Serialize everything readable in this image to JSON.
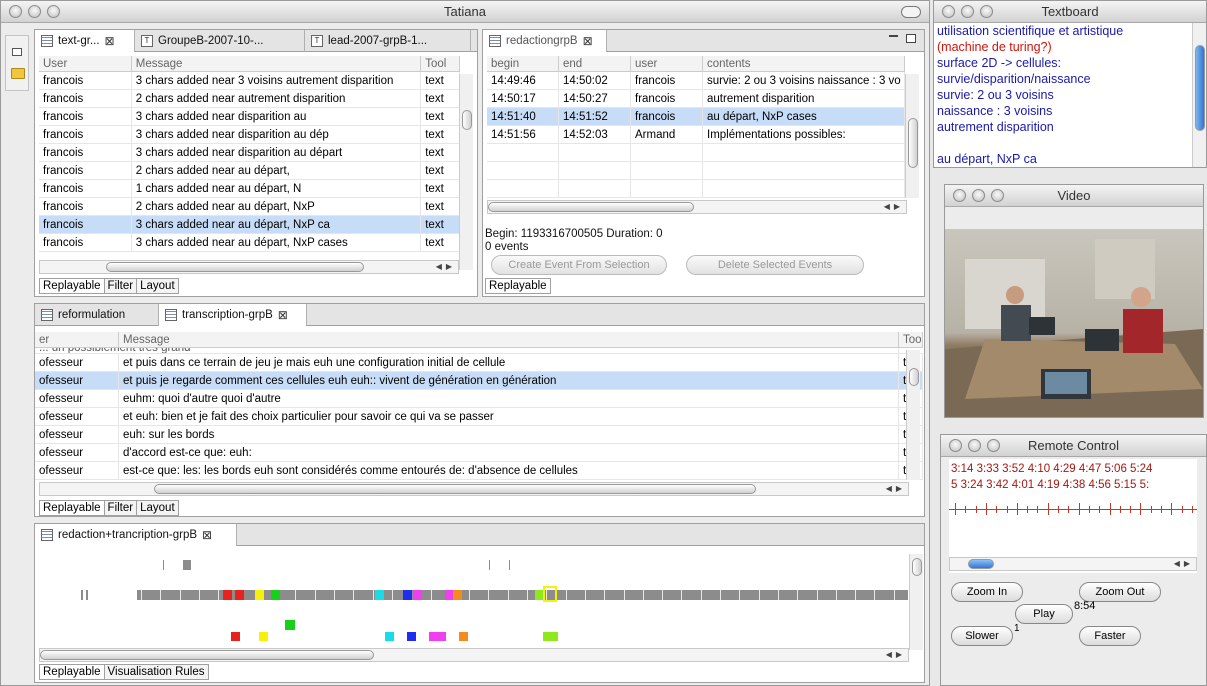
{
  "main_window": {
    "title": "Tatiana"
  },
  "panels": {
    "textgr": {
      "tabs": [
        "text-gr...",
        "GroupeB-2007-10-...",
        "lead-2007-grpB-1..."
      ],
      "columns": [
        "User",
        "Message",
        "Tool"
      ],
      "rows": [
        {
          "user": "francois",
          "message": "3 chars added near  3 voisins autrement disparition",
          "tool": "text"
        },
        {
          "user": "francois",
          "message": "2 chars added near  autrement disparition",
          "tool": "text"
        },
        {
          "user": "francois",
          "message": "3 chars added near  disparition  au",
          "tool": "text"
        },
        {
          "user": "francois",
          "message": "3 chars added near  disparition  au dép",
          "tool": "text"
        },
        {
          "user": "francois",
          "message": "3 chars added near  disparition  au départ",
          "tool": "text"
        },
        {
          "user": "francois",
          "message": "2 chars added near   au départ,",
          "tool": "text"
        },
        {
          "user": "francois",
          "message": "1 chars added near   au départ, N",
          "tool": "text"
        },
        {
          "user": "francois",
          "message": "2 chars added near   au départ, NxP",
          "tool": "text"
        },
        {
          "user": "francois",
          "message": "3 chars added near  au départ, NxP ca",
          "tool": "text"
        },
        {
          "user": "francois",
          "message": "3 chars added near  au départ, NxP cases",
          "tool": "text"
        }
      ],
      "bottom_tabs": [
        "Replayable",
        "Filter",
        "Layout"
      ]
    },
    "redaction": {
      "tab": "redactiongrpB",
      "columns": [
        "begin",
        "end",
        "user",
        "contents"
      ],
      "rows": [
        {
          "begin": "14:49:46",
          "end": "14:50:02",
          "user": "francois",
          "contents": "survie: 2 ou 3 voisins naissance : 3 vo"
        },
        {
          "begin": "14:50:17",
          "end": "14:50:27",
          "user": "francois",
          "contents": "autrement disparition"
        },
        {
          "begin": "14:51:40",
          "end": "14:51:52",
          "user": "francois",
          "contents": "au départ, NxP cases"
        },
        {
          "begin": "14:51:56",
          "end": "14:52:03",
          "user": "Armand",
          "contents": "Implémentations possibles:"
        }
      ],
      "begin_info": "Begin: 1193316700505 Duration: 0",
      "events_info": "0 events",
      "create_label": "Create Event From Selection",
      "delete_label": "Delete Selected Events",
      "bottom_tab": "Replayable"
    },
    "transcription": {
      "tabs": [
        "reformulation",
        "transcription-grpB"
      ],
      "columns": [
        "er",
        "Message",
        "Too"
      ],
      "partial_row": "... un possiblement très grand",
      "rows": [
        {
          "user": "ofesseur",
          "message": " et puis dans ce terrain de jeu je mais euh une configuration initial de cellule",
          "tool": "t"
        },
        {
          "user": "ofesseur",
          "message": "et puis je regarde comment ces cellules euh euh:: vivent de génération en génération",
          "tool": "t"
        },
        {
          "user": "ofesseur",
          "message": "euhm: quoi d'autre quoi d'autre",
          "tool": "t"
        },
        {
          "user": "ofesseur",
          "message": "et euh: bien et je fait des choix particulier pour savoir ce qui va se passer",
          "tool": "t"
        },
        {
          "user": "ofesseur",
          "message": "euh: sur les bords",
          "tool": "t"
        },
        {
          "user": "ofesseur",
          "message": "d'accord est-ce que: euh:",
          "tool": "t"
        },
        {
          "user": "ofesseur",
          "message": "est-ce que: les: les bords euh sont considérés comme entourés de: d'absence de cellules",
          "tool": "t"
        }
      ],
      "bottom_tabs": [
        "Replayable",
        "Filter",
        "Layout"
      ]
    },
    "visual": {
      "tab": "redaction+trancription-grpB",
      "bottom_tabs": [
        "Replayable",
        "Visualisation Rules"
      ],
      "colors": {
        "red": "#e8231e",
        "yellow": "#f5f10a",
        "green": "#16d11a",
        "cyan": "#18dde8",
        "blue": "#1e2df0",
        "magenta": "#f03ef0",
        "orange": "#f58a1e",
        "lime": "#8fe81e",
        "gray": "#8c8c8c"
      }
    }
  },
  "textboard": {
    "title": "Textboard",
    "lines": [
      {
        "text": "utilisation scientifique et artistique",
        "color": "#1a1aa8"
      },
      {
        "text": "(machine de turing?)",
        "color": "#d0140e"
      },
      {
        "text": "surface 2D -> cellules:",
        "color": "#1a1aa8"
      },
      {
        "text": "survie/disparition/naissance",
        "color": "#1a1aa8"
      },
      {
        "text": "survie: 2 ou 3 voisins",
        "color": "#1a1aa8"
      },
      {
        "text": "naissance : 3 voisins",
        "color": "#1a1aa8"
      },
      {
        "text": "autrement disparition",
        "color": "#1a1aa8"
      },
      {
        "text": "",
        "color": "#1a1aa8"
      },
      {
        "text": "au départ, NxP ca",
        "color": "#1a1aa8"
      }
    ]
  },
  "video": {
    "title": "Video"
  },
  "remote": {
    "title": "Remote Control",
    "row1": "3:14  3:33  3:52  4:10  4:29  4:47  5:06  5:24",
    "row2": "5  3:24  3:42  4:01  4:19  4:38  4:56  5:15  5:",
    "zoom_in": "Zoom In",
    "zoom_out": "Zoom Out",
    "play": "Play",
    "total": "8:54",
    "slower": "Slower",
    "speed": "1",
    "faster": "Faster"
  }
}
